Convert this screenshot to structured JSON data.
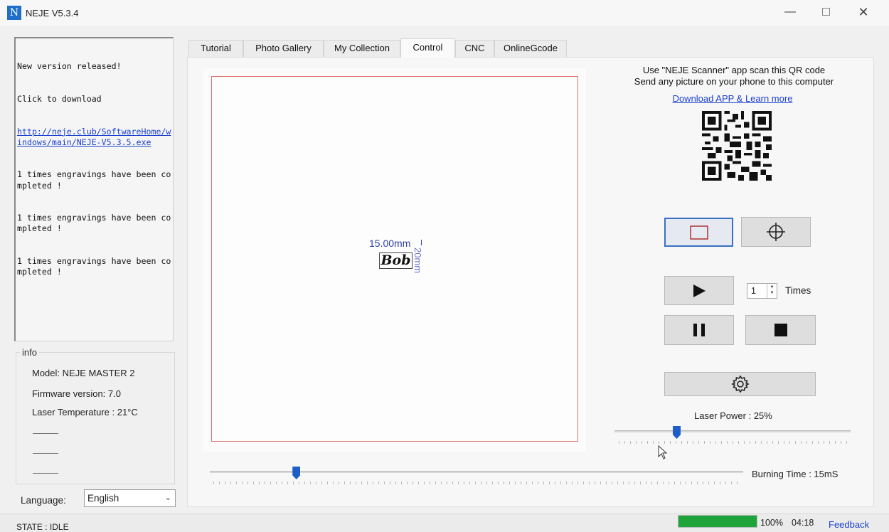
{
  "window": {
    "title": "NEJE V5.3.4",
    "icon_letter": "N"
  },
  "log": {
    "lines": [
      {
        "text": "New version released!",
        "link": false
      },
      {
        "text": "Click to download",
        "link": false
      },
      {
        "text": "http://neje.club/SoftwareHome/windows/main/NEJE-V5.3.5.exe",
        "link": true
      },
      {
        "text": "1 times engravings have been completed !",
        "link": false
      },
      {
        "text": "1 times engravings have been completed !",
        "link": false
      },
      {
        "text": "1 times engravings have been completed !",
        "link": false
      }
    ]
  },
  "info": {
    "caption": "info",
    "model": "Model: NEJE MASTER 2",
    "firmware": "Firmware version: 7.0",
    "temperature": "Laser Temperature : 21°C"
  },
  "language": {
    "label": "Language:",
    "value": "English"
  },
  "tabs": [
    {
      "label": "Tutorial",
      "active": false
    },
    {
      "label": "Photo Gallery",
      "active": false
    },
    {
      "label": "My Collection",
      "active": false
    },
    {
      "label": "Control",
      "active": true
    },
    {
      "label": "CNC",
      "active": false
    },
    {
      "label": "OnlineGcode",
      "active": false
    }
  ],
  "canvas": {
    "width_label": "15.00mm",
    "height_label": "20mm",
    "preview_text": "Bob"
  },
  "qr_panel": {
    "line1": "Use \"NEJE Scanner\" app scan this QR code",
    "line2": "Send any picture on your phone to this computer",
    "link": "Download APP & Learn more"
  },
  "controls": {
    "repeat_value": "1",
    "times_label": "Times",
    "laser_power_label": "Laser Power : 25%",
    "laser_power_percent": 25,
    "burning_time_label": "Burning Time : 15mS",
    "burning_time_fraction": 0.155
  },
  "icons": {
    "frame": "frame-rect-icon",
    "center": "crosshair-icon",
    "play": "play-icon",
    "pause": "pause-icon",
    "stop": "stop-icon",
    "settings": "gear-icon"
  },
  "status": {
    "state": "STATE : IDLE",
    "progress_percent": 100,
    "progress_label": "100%",
    "time": "04:18",
    "feedback": "Feedback"
  },
  "colors": {
    "accent": "#1d5ec9",
    "progress": "#1ea43a",
    "canvas_border": "#e07070",
    "link": "#1a3fd0"
  }
}
